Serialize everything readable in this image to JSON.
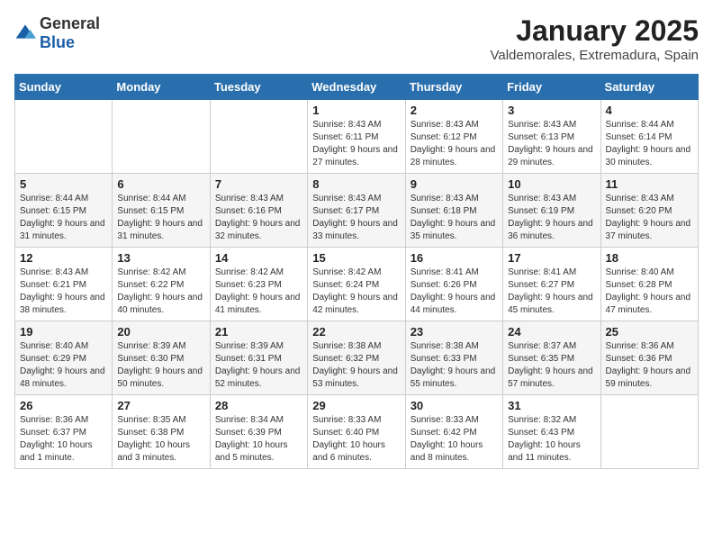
{
  "logo": {
    "general": "General",
    "blue": "Blue"
  },
  "header": {
    "month": "January 2025",
    "location": "Valdemorales, Extremadura, Spain"
  },
  "weekdays": [
    "Sunday",
    "Monday",
    "Tuesday",
    "Wednesday",
    "Thursday",
    "Friday",
    "Saturday"
  ],
  "weeks": [
    [
      {
        "day": "",
        "info": ""
      },
      {
        "day": "",
        "info": ""
      },
      {
        "day": "",
        "info": ""
      },
      {
        "day": "1",
        "info": "Sunrise: 8:43 AM\nSunset: 6:11 PM\nDaylight: 9 hours and 27 minutes."
      },
      {
        "day": "2",
        "info": "Sunrise: 8:43 AM\nSunset: 6:12 PM\nDaylight: 9 hours and 28 minutes."
      },
      {
        "day": "3",
        "info": "Sunrise: 8:43 AM\nSunset: 6:13 PM\nDaylight: 9 hours and 29 minutes."
      },
      {
        "day": "4",
        "info": "Sunrise: 8:44 AM\nSunset: 6:14 PM\nDaylight: 9 hours and 30 minutes."
      }
    ],
    [
      {
        "day": "5",
        "info": "Sunrise: 8:44 AM\nSunset: 6:15 PM\nDaylight: 9 hours and 31 minutes."
      },
      {
        "day": "6",
        "info": "Sunrise: 8:44 AM\nSunset: 6:15 PM\nDaylight: 9 hours and 31 minutes."
      },
      {
        "day": "7",
        "info": "Sunrise: 8:43 AM\nSunset: 6:16 PM\nDaylight: 9 hours and 32 minutes."
      },
      {
        "day": "8",
        "info": "Sunrise: 8:43 AM\nSunset: 6:17 PM\nDaylight: 9 hours and 33 minutes."
      },
      {
        "day": "9",
        "info": "Sunrise: 8:43 AM\nSunset: 6:18 PM\nDaylight: 9 hours and 35 minutes."
      },
      {
        "day": "10",
        "info": "Sunrise: 8:43 AM\nSunset: 6:19 PM\nDaylight: 9 hours and 36 minutes."
      },
      {
        "day": "11",
        "info": "Sunrise: 8:43 AM\nSunset: 6:20 PM\nDaylight: 9 hours and 37 minutes."
      }
    ],
    [
      {
        "day": "12",
        "info": "Sunrise: 8:43 AM\nSunset: 6:21 PM\nDaylight: 9 hours and 38 minutes."
      },
      {
        "day": "13",
        "info": "Sunrise: 8:42 AM\nSunset: 6:22 PM\nDaylight: 9 hours and 40 minutes."
      },
      {
        "day": "14",
        "info": "Sunrise: 8:42 AM\nSunset: 6:23 PM\nDaylight: 9 hours and 41 minutes."
      },
      {
        "day": "15",
        "info": "Sunrise: 8:42 AM\nSunset: 6:24 PM\nDaylight: 9 hours and 42 minutes."
      },
      {
        "day": "16",
        "info": "Sunrise: 8:41 AM\nSunset: 6:26 PM\nDaylight: 9 hours and 44 minutes."
      },
      {
        "day": "17",
        "info": "Sunrise: 8:41 AM\nSunset: 6:27 PM\nDaylight: 9 hours and 45 minutes."
      },
      {
        "day": "18",
        "info": "Sunrise: 8:40 AM\nSunset: 6:28 PM\nDaylight: 9 hours and 47 minutes."
      }
    ],
    [
      {
        "day": "19",
        "info": "Sunrise: 8:40 AM\nSunset: 6:29 PM\nDaylight: 9 hours and 48 minutes."
      },
      {
        "day": "20",
        "info": "Sunrise: 8:39 AM\nSunset: 6:30 PM\nDaylight: 9 hours and 50 minutes."
      },
      {
        "day": "21",
        "info": "Sunrise: 8:39 AM\nSunset: 6:31 PM\nDaylight: 9 hours and 52 minutes."
      },
      {
        "day": "22",
        "info": "Sunrise: 8:38 AM\nSunset: 6:32 PM\nDaylight: 9 hours and 53 minutes."
      },
      {
        "day": "23",
        "info": "Sunrise: 8:38 AM\nSunset: 6:33 PM\nDaylight: 9 hours and 55 minutes."
      },
      {
        "day": "24",
        "info": "Sunrise: 8:37 AM\nSunset: 6:35 PM\nDaylight: 9 hours and 57 minutes."
      },
      {
        "day": "25",
        "info": "Sunrise: 8:36 AM\nSunset: 6:36 PM\nDaylight: 9 hours and 59 minutes."
      }
    ],
    [
      {
        "day": "26",
        "info": "Sunrise: 8:36 AM\nSunset: 6:37 PM\nDaylight: 10 hours and 1 minute."
      },
      {
        "day": "27",
        "info": "Sunrise: 8:35 AM\nSunset: 6:38 PM\nDaylight: 10 hours and 3 minutes."
      },
      {
        "day": "28",
        "info": "Sunrise: 8:34 AM\nSunset: 6:39 PM\nDaylight: 10 hours and 5 minutes."
      },
      {
        "day": "29",
        "info": "Sunrise: 8:33 AM\nSunset: 6:40 PM\nDaylight: 10 hours and 6 minutes."
      },
      {
        "day": "30",
        "info": "Sunrise: 8:33 AM\nSunset: 6:42 PM\nDaylight: 10 hours and 8 minutes."
      },
      {
        "day": "31",
        "info": "Sunrise: 8:32 AM\nSunset: 6:43 PM\nDaylight: 10 hours and 11 minutes."
      },
      {
        "day": "",
        "info": ""
      }
    ]
  ]
}
